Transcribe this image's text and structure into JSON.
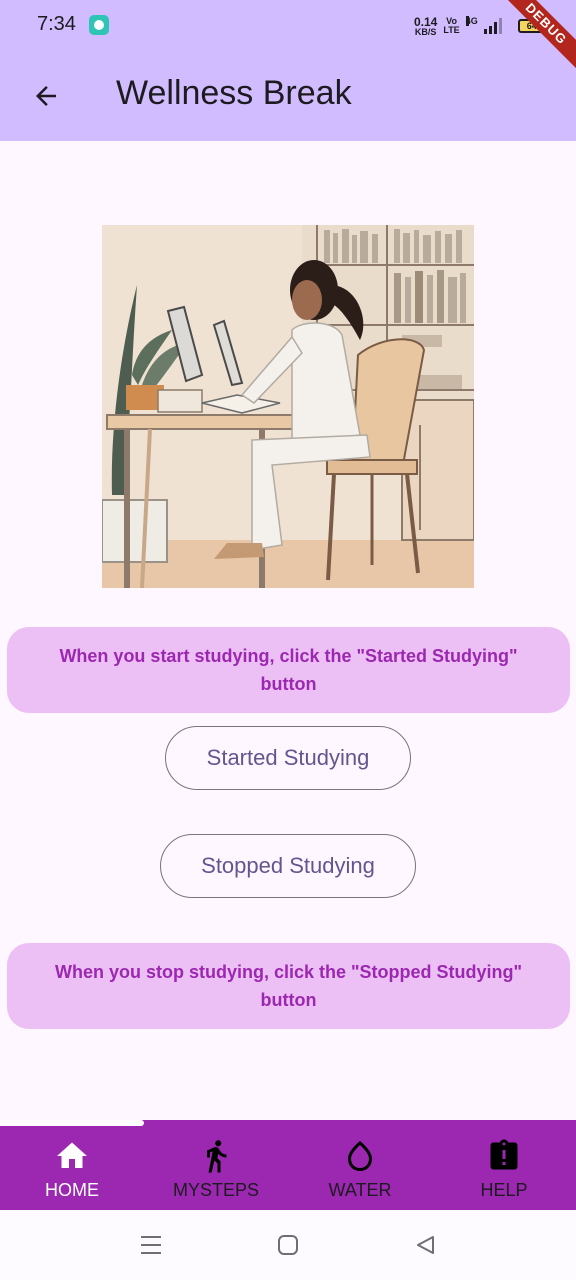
{
  "status_bar": {
    "time": "7:34",
    "net_speed_value": "0.14",
    "net_speed_unit": "KB/S",
    "volte_top": "Vo",
    "volte_bottom": "LTE",
    "network": "4G",
    "battery": "64",
    "debug_banner": "DEBUG"
  },
  "app_bar": {
    "title": "Wellness Break",
    "back_icon": "arrow-back-icon"
  },
  "main": {
    "start_info": "When you start studying, click the \"Started Studying\" button",
    "start_button": "Started Studying",
    "stop_button": "Stopped Studying",
    "stop_info": "When you stop studying, click the \"Stopped Studying\" button"
  },
  "bottom_nav": {
    "selected_index": 0,
    "items": [
      {
        "label": "HOME",
        "icon": "home-icon"
      },
      {
        "label": "MYSTEPS",
        "icon": "walking-person-icon"
      },
      {
        "label": "WATER",
        "icon": "water-drop-icon"
      },
      {
        "label": "HELP",
        "icon": "clipboard-alert-icon"
      }
    ]
  },
  "colors": {
    "app_bar_bg": "#d0bcff",
    "page_bg": "#fef7ff",
    "info_box_bg": "#ecc0f5",
    "info_text": "#9c27b0",
    "button_text": "#65558f",
    "bottom_nav_bg": "#9c27b0"
  }
}
